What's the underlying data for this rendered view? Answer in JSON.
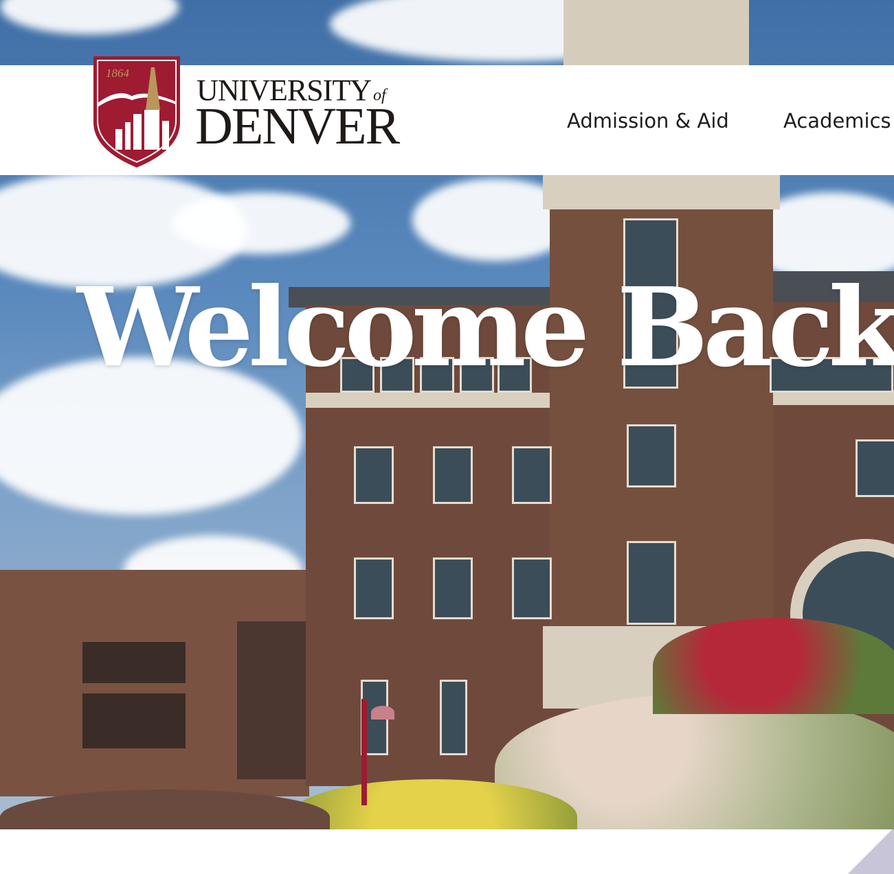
{
  "header": {
    "logo": {
      "year": "1864",
      "wordmark_top": "UNIVERSITY",
      "wordmark_of": "of",
      "wordmark_bottom": "DENVER"
    },
    "nav_items": [
      {
        "label": "Admission & Aid"
      },
      {
        "label": "Academics"
      }
    ]
  },
  "hero": {
    "title": "Welcome Back,"
  },
  "colors": {
    "brand_crimson": "#9e1b32",
    "brand_gold": "#b9975b",
    "header_bg": "#ffffff",
    "hero_text": "#ffffff"
  }
}
